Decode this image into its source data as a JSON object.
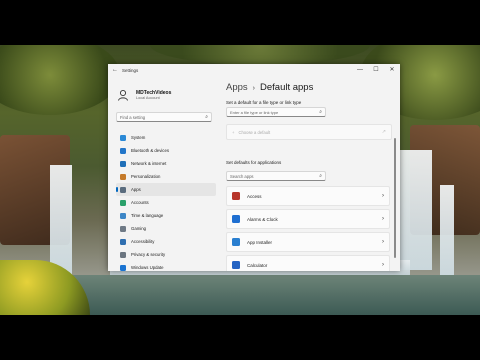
{
  "window": {
    "title": "Settings",
    "back_glyph": "←",
    "controls": {
      "minimize": "—",
      "maximize": "☐",
      "close": "✕"
    }
  },
  "user": {
    "name": "MDTechVideos",
    "account": "Local Account"
  },
  "search": {
    "placeholder": "Find a setting",
    "icon": "search-icon"
  },
  "nav": [
    {
      "label": "System",
      "icon": "system-icon",
      "color": "#2b89d6"
    },
    {
      "label": "Bluetooth & devices",
      "icon": "bluetooth-icon",
      "color": "#2376c9"
    },
    {
      "label": "Network & internet",
      "icon": "network-icon",
      "color": "#1f6fb8"
    },
    {
      "label": "Personalization",
      "icon": "personalization-icon",
      "color": "#c57a2a"
    },
    {
      "label": "Apps",
      "icon": "apps-icon",
      "color": "#5a6c7e",
      "active": true
    },
    {
      "label": "Accounts",
      "icon": "accounts-icon",
      "color": "#2aa06a"
    },
    {
      "label": "Time & language",
      "icon": "time-language-icon",
      "color": "#3d86c6"
    },
    {
      "label": "Gaming",
      "icon": "gaming-icon",
      "color": "#6f7a86"
    },
    {
      "label": "Accessibility",
      "icon": "accessibility-icon",
      "color": "#2f6fb0"
    },
    {
      "label": "Privacy & security",
      "icon": "privacy-icon",
      "color": "#6b7580"
    },
    {
      "label": "Windows Update",
      "icon": "windows-update-icon",
      "color": "#1a73d1"
    }
  ],
  "main": {
    "breadcrumb": {
      "parent": "Apps",
      "separator": "›",
      "current": "Default apps"
    },
    "file_type_heading": "Set a default for a file type or link type",
    "file_type_placeholder": "Enter a file type or link type",
    "choose_default": "Choose a default",
    "choose_plus": "+",
    "choose_ext": "↗",
    "apps_heading": "Set defaults for applications",
    "apps_search_placeholder": "Search apps",
    "apps": [
      {
        "name": "Access",
        "icon": "access-icon",
        "color": "#b7352a"
      },
      {
        "name": "Alarms & Clock",
        "icon": "alarms-clock-icon",
        "color": "#1f6fd1"
      },
      {
        "name": "App Installer",
        "icon": "app-installer-icon",
        "color": "#2a7fd0"
      },
      {
        "name": "Calculator",
        "icon": "calculator-icon",
        "color": "#2463c3"
      }
    ],
    "chevron": "›"
  },
  "colors": {
    "accent": "#0067c0",
    "window_bg": "#f3f3f3"
  }
}
